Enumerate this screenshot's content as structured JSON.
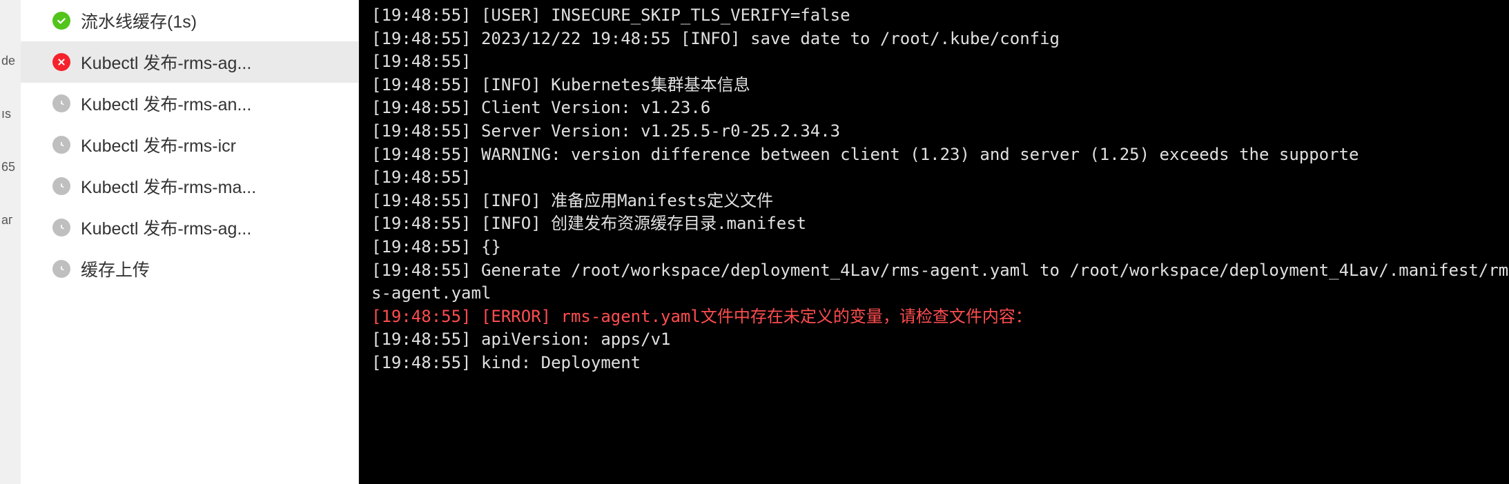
{
  "left_edge": {
    "items": [
      "de",
      "ıs",
      "65",
      "аг"
    ]
  },
  "sidebar": {
    "items": [
      {
        "status": "success",
        "label": "流水线缓存(1s)",
        "selected": false
      },
      {
        "status": "error",
        "label": "Kubectl 发布-rms-ag...",
        "selected": true
      },
      {
        "status": "pending",
        "label": "Kubectl 发布-rms-an...",
        "selected": false
      },
      {
        "status": "pending",
        "label": "Kubectl 发布-rms-icr",
        "selected": false
      },
      {
        "status": "pending",
        "label": "Kubectl 发布-rms-ma...",
        "selected": false
      },
      {
        "status": "pending",
        "label": "Kubectl 发布-rms-ag...",
        "selected": false
      },
      {
        "status": "pending",
        "label": "缓存上传",
        "selected": false
      }
    ]
  },
  "terminal": {
    "lines": [
      {
        "text": "[19:48:55] [USER] INSECURE_SKIP_TLS_VERIFY=false",
        "type": "normal"
      },
      {
        "text": "[19:48:55] 2023/12/22 19:48:55 [INFO] save date to /root/.kube/config",
        "type": "normal"
      },
      {
        "text": "[19:48:55]",
        "type": "normal"
      },
      {
        "text": "[19:48:55] [INFO] Kubernetes集群基本信息",
        "type": "normal"
      },
      {
        "text": "[19:48:55] Client Version: v1.23.6",
        "type": "normal"
      },
      {
        "text": "[19:48:55] Server Version: v1.25.5-r0-25.2.34.3",
        "type": "normal"
      },
      {
        "text": "[19:48:55] WARNING: version difference between client (1.23) and server (1.25) exceeds the supporte",
        "type": "normal"
      },
      {
        "text": "[19:48:55]",
        "type": "normal"
      },
      {
        "text": "[19:48:55] [INFO] 准备应用Manifests定义文件",
        "type": "normal"
      },
      {
        "text": "[19:48:55] [INFO] 创建发布资源缓存目录.manifest",
        "type": "normal"
      },
      {
        "text": "[19:48:55] {}",
        "type": "normal"
      },
      {
        "text": "[19:48:55] Generate /root/workspace/deployment_4Lav/rms-agent.yaml to /root/workspace/deployment_4Lav/.manifest/rms-agent.yaml",
        "type": "normal"
      },
      {
        "text": "[19:48:55] [ERROR] rms-agent.yaml文件中存在未定义的变量，请检查文件内容：",
        "type": "error"
      },
      {
        "text": "[19:48:55] apiVersion: apps/v1",
        "type": "normal"
      },
      {
        "text": "[19:48:55] kind: Deployment",
        "type": "normal"
      }
    ]
  }
}
